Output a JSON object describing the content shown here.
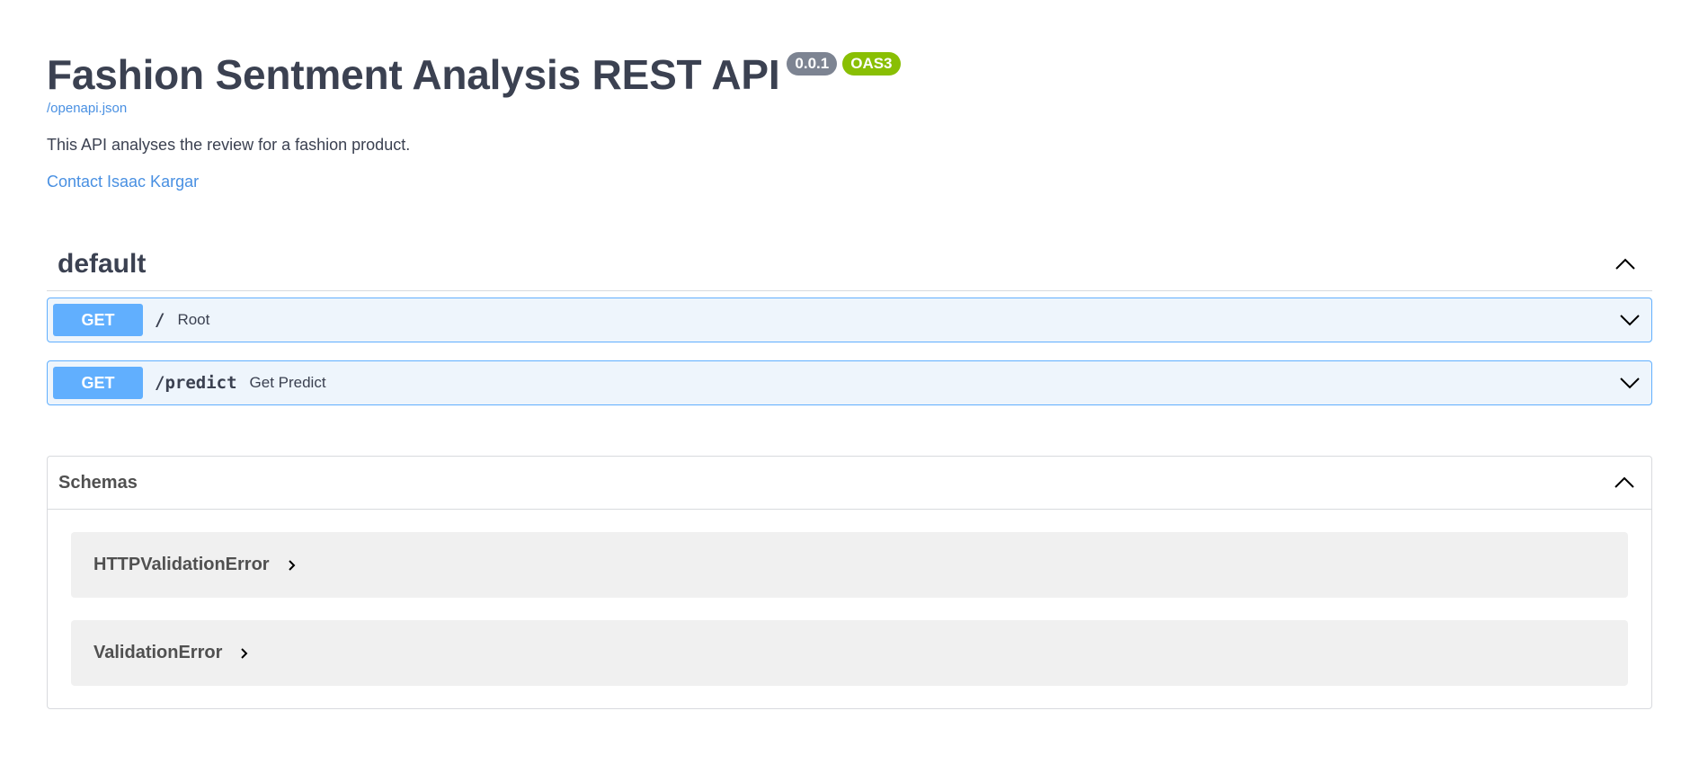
{
  "info": {
    "title": "Fashion Sentment Analysis REST API",
    "version": "0.0.1",
    "oas_badge": "OAS3",
    "spec_url": "/openapi.json",
    "description": "This API analyses the review for a fashion product.",
    "contact": "Contact Isaac Kargar"
  },
  "tag": {
    "name": "default",
    "operations": [
      {
        "method": "GET",
        "path": "/",
        "summary": "Root"
      },
      {
        "method": "GET",
        "path": "/predict",
        "summary": "Get Predict"
      }
    ]
  },
  "schemas": {
    "title": "Schemas",
    "models": [
      {
        "name": "HTTPValidationError"
      },
      {
        "name": "ValidationError"
      }
    ]
  },
  "colors": {
    "get_method": "#61affe",
    "get_background": "#eef5fc",
    "version_badge": "#7d8492",
    "oas_badge": "#89bf04",
    "link": "#4990e2"
  },
  "icons": {
    "tag_toggle": "chevron-up-icon",
    "operation_expand": "chevron-down-icon",
    "schemas_toggle": "chevron-up-icon",
    "model_expand": "chevron-right-icon"
  }
}
